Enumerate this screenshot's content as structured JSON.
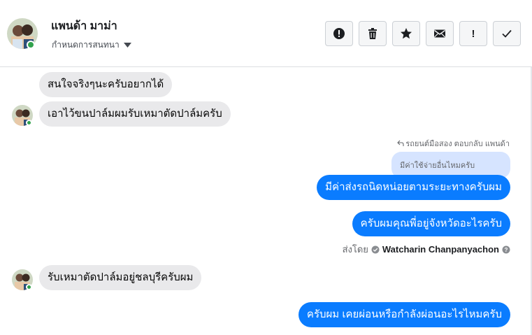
{
  "header": {
    "name": "แพนด้า มาม่า",
    "assign_label": "กำหนดการสนทนา"
  },
  "toolbar": {
    "buttons": [
      {
        "icon": "alert-circle-icon",
        "name": "spam"
      },
      {
        "icon": "trash-icon",
        "name": "delete"
      },
      {
        "icon": "star-icon",
        "name": "star"
      },
      {
        "icon": "envelope-icon",
        "name": "mark-unread"
      },
      {
        "icon": "exclamation-icon",
        "name": "follow-up",
        "glyph": "!"
      },
      {
        "icon": "check-icon",
        "name": "done"
      }
    ]
  },
  "messages": [
    {
      "direction": "in",
      "text": "สนใจจริงๆนะครับอยากได้"
    },
    {
      "direction": "in",
      "text": "เอาไว้ขนปาล์มผมรับเหมาตัดปาล์มครับ"
    },
    {
      "direction": "out",
      "text": "มีค่าส่งรถนิดหน่อยตามระยะทางครับผม"
    },
    {
      "direction": "out",
      "text": "ครับผมคุณพี่อยู่จังหวัดอะไรครับ"
    },
    {
      "direction": "in",
      "text": "รับเหมาตัดปาล์มอยู่ชลบุรีครับผม"
    },
    {
      "direction": "out",
      "text": "ครับผม เคยผ่อนหรือกำลังผ่อนอะไรไหมครับ"
    }
  ],
  "reply": {
    "label": "รถยนต์มือสอง ตอบกลับ แพนด้า",
    "quoted_text": "มีค่าใช้จ่ายอื่นไหมครับ"
  },
  "sent_by": {
    "prefix": "ส่งโดย",
    "name": "Watcharin Chanpanyachon"
  },
  "colors": {
    "outgoing_bubble": "#0a7cff",
    "incoming_bubble": "#e9e9eb",
    "quoted_bubble": "#d6e4ff",
    "online": "#31a24c"
  }
}
